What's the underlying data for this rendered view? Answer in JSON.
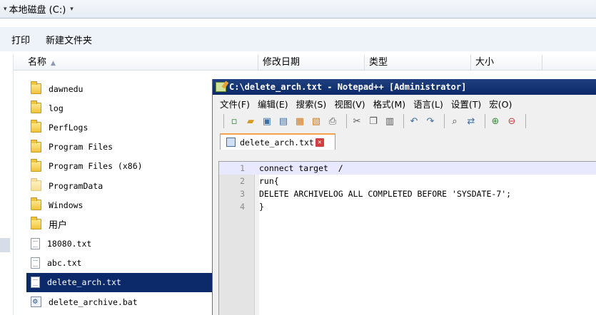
{
  "address": {
    "segments": [
      "本地磁盘 (C:)"
    ]
  },
  "commandbar": {
    "print": "打印",
    "new_folder": "新建文件夹"
  },
  "columns": {
    "name": "名称",
    "date": "修改日期",
    "type": "类型",
    "size": "大小"
  },
  "files": [
    {
      "name": "dawnedu",
      "kind": "folder"
    },
    {
      "name": "log",
      "kind": "folder"
    },
    {
      "name": "PerfLogs",
      "kind": "folder"
    },
    {
      "name": "Program Files",
      "kind": "folder"
    },
    {
      "name": "Program Files (x86)",
      "kind": "folder"
    },
    {
      "name": "ProgramData",
      "kind": "folder"
    },
    {
      "name": "Windows",
      "kind": "folder"
    },
    {
      "name": "用户",
      "kind": "folder"
    },
    {
      "name": "18080.txt",
      "kind": "doc"
    },
    {
      "name": "abc.txt",
      "kind": "doc"
    },
    {
      "name": "delete_arch.txt",
      "kind": "doc",
      "selected": true
    },
    {
      "name": "delete_archive.bat",
      "kind": "bat"
    }
  ],
  "npp": {
    "title": "C:\\delete_arch.txt - Notepad++ [Administrator]",
    "menu": [
      "文件(F)",
      "编辑(E)",
      "搜索(S)",
      "视图(V)",
      "格式(M)",
      "语言(L)",
      "设置(T)",
      "宏(O)"
    ],
    "tab_label": "delete_arch.txt",
    "lines": [
      {
        "n": "1",
        "text": "connect target  /"
      },
      {
        "n": "2",
        "text": "run{"
      },
      {
        "n": "3",
        "text": "DELETE ARCHIVELOG ALL COMPLETED BEFORE 'SYSDATE-7';"
      },
      {
        "n": "4",
        "text": "}"
      }
    ]
  },
  "colors": {
    "title_bar": "#0c2a6a",
    "selection": "#0c2a6a",
    "current_line": "#e8e8ff",
    "tab_accent": "#f4a14a"
  }
}
